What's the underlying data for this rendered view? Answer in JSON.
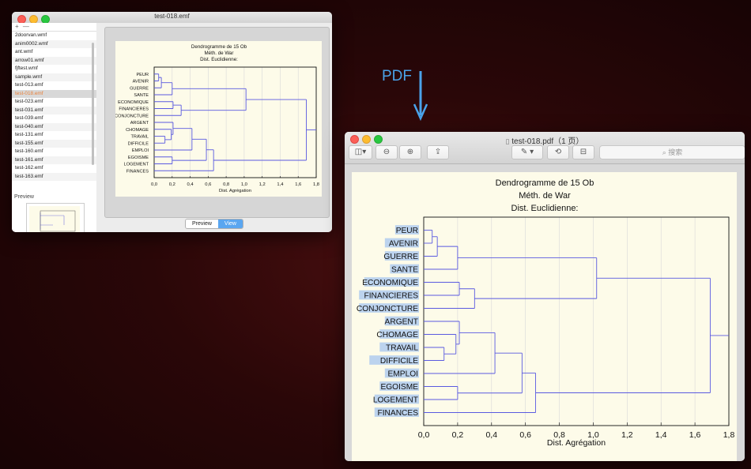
{
  "window1": {
    "title": "test-018.emf",
    "toolbar": {
      "add": "+",
      "remove": "—"
    },
    "files": [
      "2doorvan.wmf",
      "anim0002.wmf",
      "ant.wmf",
      "arrow01.wmf",
      "fjftest.wmf",
      "sample.wmf",
      "test-013.emf",
      "test-018.emf",
      "test-023.emf",
      "test-031.emf",
      "test-039.emf",
      "test-040.emf",
      "test-131.emf",
      "test-155.emf",
      "test-160.emf",
      "test-161.emf",
      "test-162.emf",
      "test-163.emf"
    ],
    "selected_file": "test-018.emf",
    "preview_label": "Preview",
    "segments": {
      "preview": "Preview",
      "view": "View"
    }
  },
  "arrow_label": "PDF",
  "window2": {
    "title": "test-018.pdf（1 页）",
    "search_placeholder": "搜索",
    "icons": [
      "sidebar-icon",
      "zoom-out-icon",
      "zoom-in-icon",
      "share-icon",
      "markup-icon",
      "rotate-icon",
      "toolbox-icon",
      "search-icon",
      "document-icon"
    ]
  },
  "chart_data": {
    "type": "dendrogram",
    "title_lines": [
      "Dendrogramme de 15 Ob",
      "Méth. de War",
      "Dist. Euclidienne:"
    ],
    "xlabel": "Dist. Agrégation",
    "xlim": [
      0,
      1.8
    ],
    "xticks": [
      "0,0",
      "0,2",
      "0,4",
      "0,6",
      "0,8",
      "1,0",
      "1,2",
      "1,4",
      "1,6",
      "1,8"
    ],
    "leaves": [
      "PEUR",
      "AVENIR",
      "GUERRE",
      "SANTE",
      "ECONOMIQUE",
      "FINANCIERES",
      "CONJONCTURE",
      "ARGENT",
      "CHOMAGE",
      "TRAVAIL",
      "DIFFICILE",
      "EMPLOI",
      "EGOISME",
      "LOGEMENT",
      "FINANCES"
    ],
    "merges": [
      {
        "id": "c1",
        "left": "PEUR",
        "right": "AVENIR",
        "height": 0.05
      },
      {
        "id": "c2",
        "left": "c1",
        "right": "GUERRE",
        "height": 0.08
      },
      {
        "id": "c3",
        "left": "c2",
        "right": "SANTE",
        "height": 0.2
      },
      {
        "id": "c4",
        "left": "ECONOMIQUE",
        "right": "FINANCIERES",
        "height": 0.21
      },
      {
        "id": "c5",
        "left": "c4",
        "right": "CONJONCTURE",
        "height": 0.3
      },
      {
        "id": "c6",
        "left": "c3",
        "right": "c5",
        "height": 1.02
      },
      {
        "id": "c7",
        "left": "TRAVAIL",
        "right": "DIFFICILE",
        "height": 0.12
      },
      {
        "id": "c8",
        "left": "CHOMAGE",
        "right": "c7",
        "height": 0.19
      },
      {
        "id": "c9",
        "left": "ARGENT",
        "right": "c8",
        "height": 0.21
      },
      {
        "id": "c10",
        "left": "c9",
        "right": "EMPLOI",
        "height": 0.42
      },
      {
        "id": "c11",
        "left": "EGOISME",
        "right": "LOGEMENT",
        "height": 0.2
      },
      {
        "id": "c12",
        "left": "c10",
        "right": "c11",
        "height": 0.58
      },
      {
        "id": "c13",
        "left": "c12",
        "right": "FINANCES",
        "height": 0.66
      },
      {
        "id": "c14",
        "left": "c6",
        "right": "c13",
        "height": 1.69
      }
    ],
    "grid": true,
    "line_color": "#5a5ae0",
    "label_highlight_color": "#bcd3ee"
  }
}
